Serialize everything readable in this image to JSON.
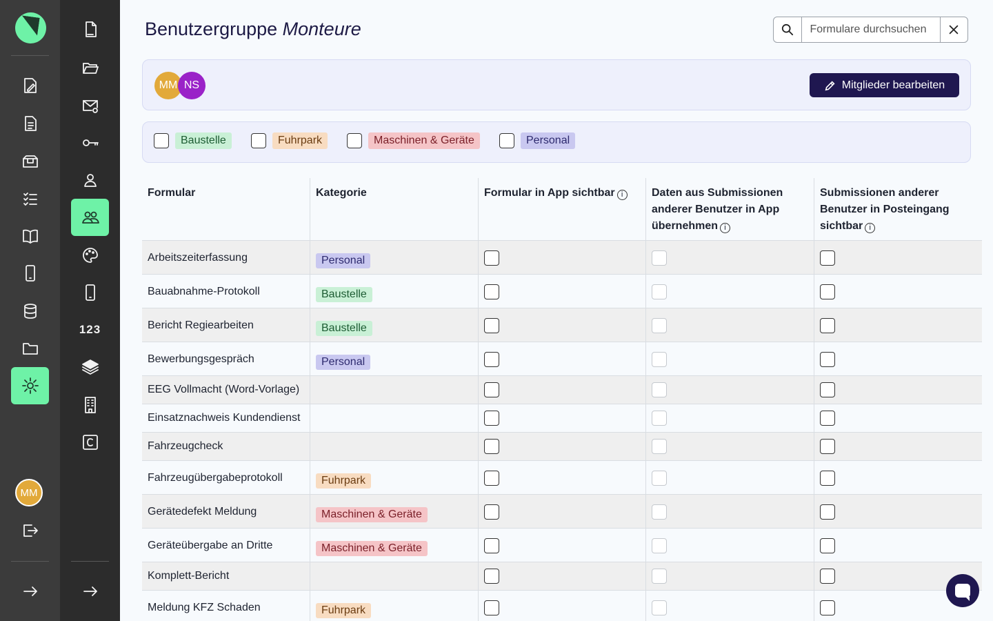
{
  "page": {
    "title_prefix": "Benutzergruppe",
    "title_group": "Monteure",
    "search_placeholder": "Formulare durchsuchen"
  },
  "rail1": {
    "user_initials": "MM",
    "user_avatar_color": "#e2a93a",
    "active_item": "settings",
    "accent_color": "#6ef2a7"
  },
  "rail2": {
    "number_label": "123",
    "active_item": "user-groups"
  },
  "members": {
    "avatars": [
      {
        "initials": "MM",
        "color": "#e2a93a"
      },
      {
        "initials": "NS",
        "color": "#9a22c8"
      }
    ],
    "edit_label": "Mitglieder bearbeiten"
  },
  "categories": [
    {
      "label": "Baustelle",
      "bg": "#c9f0d6",
      "fg": "#1d5c33"
    },
    {
      "label": "Fuhrpark",
      "bg": "#f8dcc1",
      "fg": "#6b3d12"
    },
    {
      "label": "Maschinen & Geräte",
      "bg": "#f5c4c7",
      "fg": "#7a1f28"
    },
    {
      "label": "Personal",
      "bg": "#c9c8f0",
      "fg": "#2d2a6e"
    }
  ],
  "table": {
    "headers": {
      "form": "Formular",
      "category": "Kategorie",
      "visible_in_app": "Formular in App sichtbar",
      "take_data": "Daten aus Submissionen anderer Benutzer in App übernehmen",
      "inbox_visible": "Submissionen anderer Benutzer in Posteingang sichtbar"
    },
    "info_symbol": "i",
    "rows": [
      {
        "name": "Arbeitszeiterfassung",
        "category": "Personal"
      },
      {
        "name": "Bauabnahme-Protokoll",
        "category": "Baustelle"
      },
      {
        "name": "Bericht Regiearbeiten",
        "category": "Baustelle"
      },
      {
        "name": "Bewerbungsgespräch",
        "category": "Personal"
      },
      {
        "name": "EEG Vollmacht (Word-Vorlage)",
        "category": ""
      },
      {
        "name": "Einsatznachweis Kundendienst",
        "category": ""
      },
      {
        "name": "Fahrzeugcheck",
        "category": ""
      },
      {
        "name": "Fahrzeugübergabeprotokoll",
        "category": "Fuhrpark"
      },
      {
        "name": "Gerätedefekt Meldung",
        "category": "Maschinen & Geräte"
      },
      {
        "name": "Geräteübergabe an Dritte",
        "category": "Maschinen & Geräte"
      },
      {
        "name": "Komplett-Bericht",
        "category": ""
      },
      {
        "name": "Meldung KFZ Schaden",
        "category": "Fuhrpark"
      }
    ]
  }
}
